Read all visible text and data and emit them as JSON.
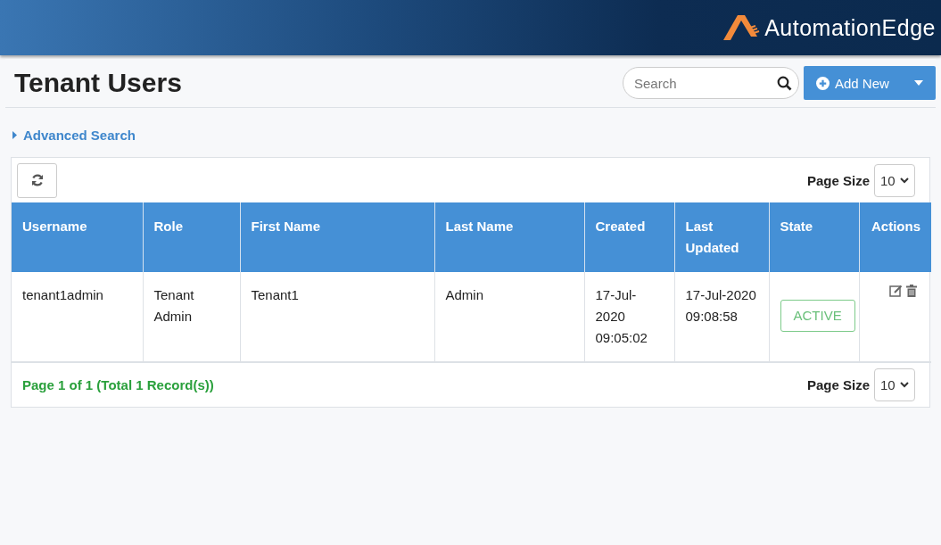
{
  "brand": {
    "name": "AutomationEdge"
  },
  "page": {
    "title": "Tenant Users"
  },
  "search": {
    "placeholder": "Search"
  },
  "add_button": {
    "label": "Add New"
  },
  "advanced_search": {
    "label": "Advanced Search",
    "expanded": false
  },
  "toolbar": {
    "page_size_label": "Page Size",
    "page_size": "10"
  },
  "table": {
    "columns": [
      "Username",
      "Role",
      "First Name",
      "Last Name",
      "Created",
      "Last Updated",
      "State",
      "Actions"
    ],
    "rows": [
      {
        "cells": [
          "tenant1admin",
          "Tenant Admin",
          "Tenant1",
          "Admin",
          "17-Jul-2020 09:05:02",
          "17-Jul-2020 09:08:58"
        ],
        "state": "ACTIVE",
        "active": true
      }
    ]
  },
  "footer": {
    "summary": "Page 1 of 1 (Total 1 Record(s))",
    "page_size_label": "Page Size",
    "page_size": "10"
  }
}
